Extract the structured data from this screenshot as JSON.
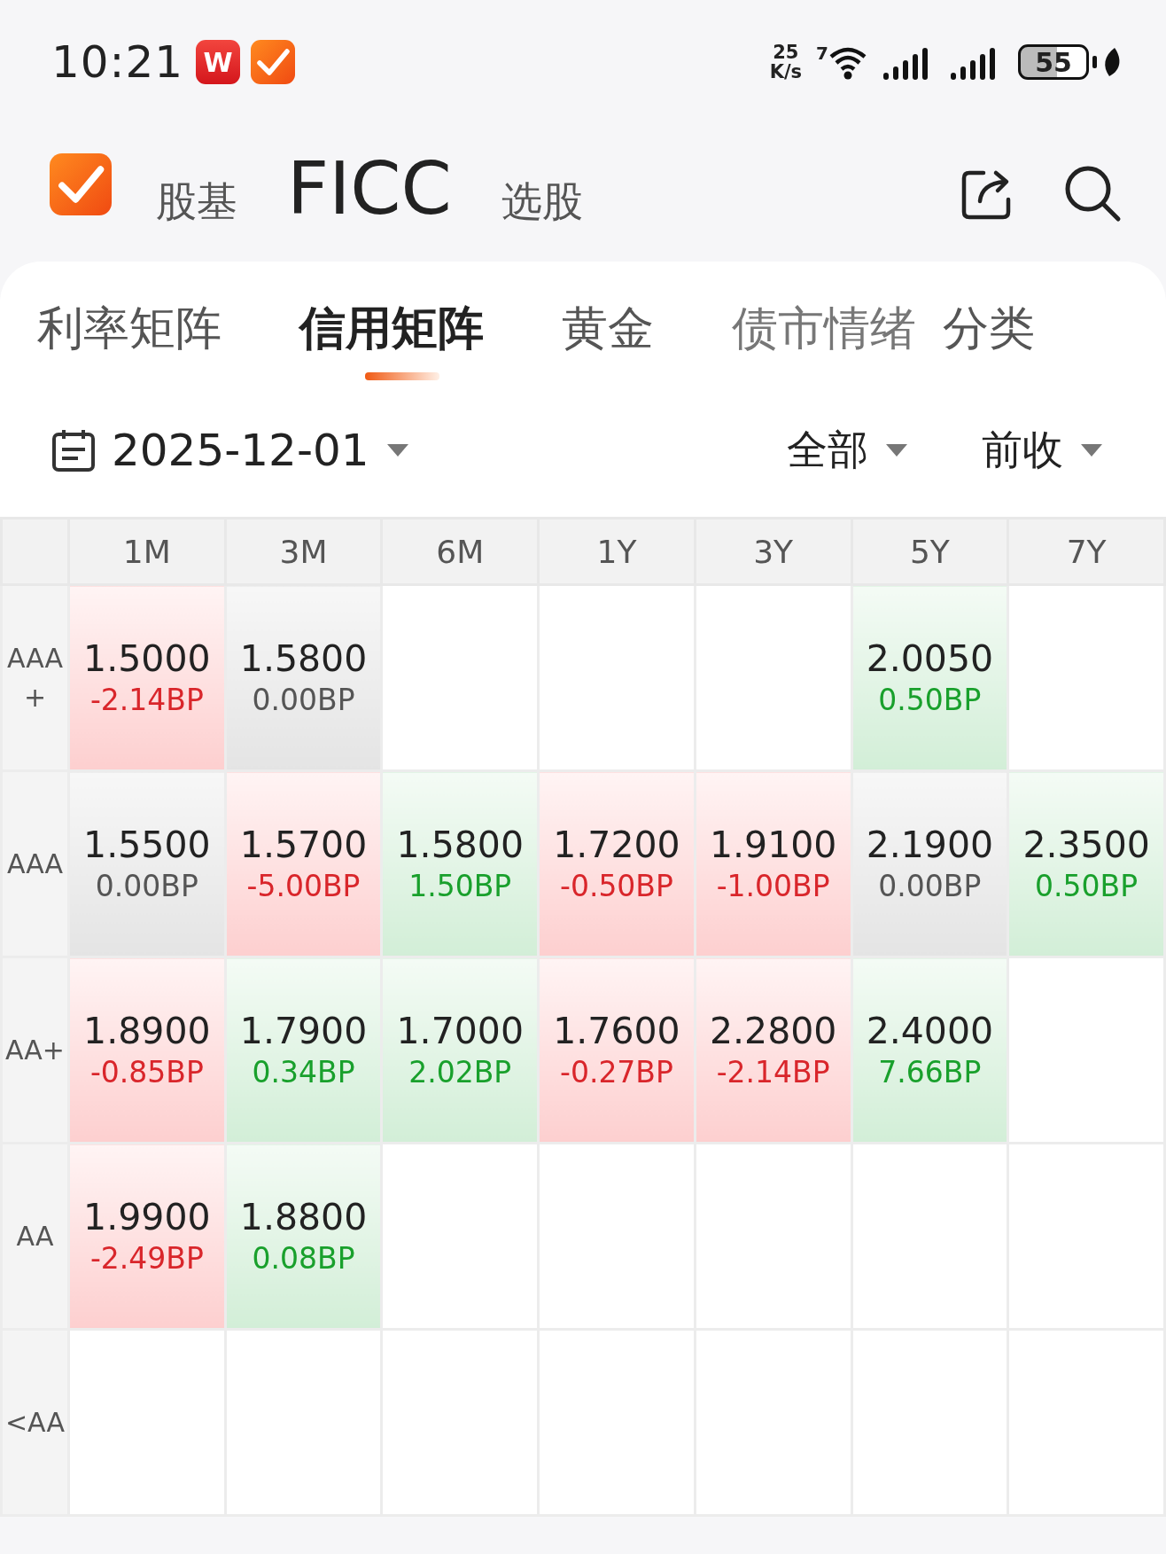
{
  "status_bar": {
    "time": "10:21",
    "notifications": [
      {
        "kind": "letter",
        "text": "W"
      },
      {
        "kind": "check"
      }
    ],
    "net_speed": "25",
    "net_unit": "K/s",
    "wifi_label": "7",
    "battery": "55"
  },
  "header": {
    "nav": [
      {
        "label": "股基",
        "selected": false
      },
      {
        "label": "FICC",
        "selected": true
      },
      {
        "label": "选股",
        "selected": false
      }
    ]
  },
  "tabs": [
    {
      "label": "利率矩阵",
      "selected": false
    },
    {
      "label": "信用矩阵",
      "selected": true
    },
    {
      "label": "黄金",
      "selected": false
    },
    {
      "label": "债市情绪",
      "selected": false
    },
    {
      "label": "分类",
      "selected": false
    }
  ],
  "filters": {
    "date": "2025-12-01",
    "scope": "全部",
    "basis": "前收"
  },
  "table": {
    "columns": [
      "1M",
      "3M",
      "6M",
      "1Y",
      "3Y",
      "5Y",
      "7Y"
    ],
    "rows": [
      {
        "rating": "AAA+",
        "cells": [
          {
            "value": "1.5000",
            "change": "-2.14BP",
            "kind": "down"
          },
          {
            "value": "1.5800",
            "change": "0.00BP",
            "kind": "flat"
          },
          null,
          null,
          null,
          {
            "value": "2.0050",
            "change": "0.50BP",
            "kind": "up"
          },
          null
        ]
      },
      {
        "rating": "AAA",
        "cells": [
          {
            "value": "1.5500",
            "change": "0.00BP",
            "kind": "flat"
          },
          {
            "value": "1.5700",
            "change": "-5.00BP",
            "kind": "down"
          },
          {
            "value": "1.5800",
            "change": "1.50BP",
            "kind": "up"
          },
          {
            "value": "1.7200",
            "change": "-0.50BP",
            "kind": "down"
          },
          {
            "value": "1.9100",
            "change": "-1.00BP",
            "kind": "down"
          },
          {
            "value": "2.1900",
            "change": "0.00BP",
            "kind": "flat"
          },
          {
            "value": "2.3500",
            "change": "0.50BP",
            "kind": "up"
          }
        ]
      },
      {
        "rating": "AA+",
        "cells": [
          {
            "value": "1.8900",
            "change": "-0.85BP",
            "kind": "down"
          },
          {
            "value": "1.7900",
            "change": "0.34BP",
            "kind": "up"
          },
          {
            "value": "1.7000",
            "change": "2.02BP",
            "kind": "up"
          },
          {
            "value": "1.7600",
            "change": "-0.27BP",
            "kind": "down"
          },
          {
            "value": "2.2800",
            "change": "-2.14BP",
            "kind": "down"
          },
          {
            "value": "2.4000",
            "change": "7.66BP",
            "kind": "up"
          },
          null
        ]
      },
      {
        "rating": "AA",
        "cells": [
          {
            "value": "1.9900",
            "change": "-2.49BP",
            "kind": "down"
          },
          {
            "value": "1.8800",
            "change": "0.08BP",
            "kind": "up"
          },
          null,
          null,
          null,
          null,
          null
        ]
      },
      {
        "rating": "<AA",
        "cells": [
          null,
          null,
          null,
          null,
          null,
          null,
          null
        ]
      }
    ]
  }
}
